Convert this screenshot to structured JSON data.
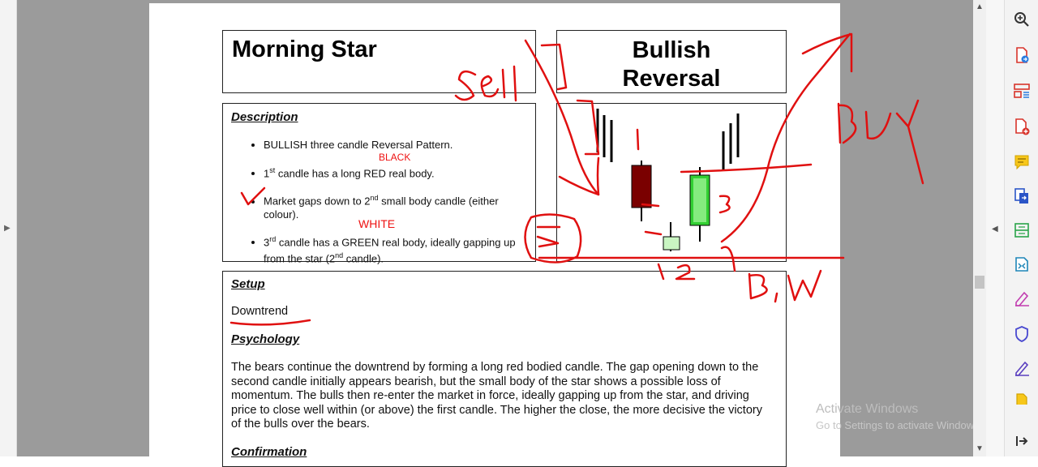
{
  "doc": {
    "title_left": "Morning Star",
    "title_right_line1": "Bullish",
    "title_right_line2": "Reversal",
    "description": {
      "heading": "Description",
      "bullets": [
        {
          "pre": "BULLISH three candle Reversal Pattern.",
          "sup": "",
          "post": ""
        },
        {
          "pre": "1",
          "sup": "st",
          "post": " candle has a long RED real body."
        },
        {
          "pre": "Market gaps down to 2",
          "sup": "nd",
          "post": " small body candle (either colour)."
        },
        {
          "pre": "3",
          "sup": "rd",
          "post": " candle has a GREEN real body, ideally gapping up from the star (2",
          "sup2": "nd",
          "post2": " candle)."
        }
      ]
    },
    "setup": {
      "heading": "Setup",
      "text": "Downtrend"
    },
    "psychology": {
      "heading": "Psychology",
      "text": "The bears continue the downtrend by forming a long red bodied candle. The gap opening down to the second candle initially appears bearish, but the small body of the star shows a possible loss of momentum. The bulls then re-enter the market in force, ideally gapping up from the star, and driving price to close well within (or above) the first candle. The higher the close, the more decisive the victory of the bulls over the bears."
    },
    "confirmation": {
      "heading": "Confirmation"
    }
  },
  "annotations": {
    "typed_black": "BLACK",
    "typed_white": "WHITE",
    "hand_sell": "Sell",
    "hand_buy": "BUY",
    "hand_bw": "B, W",
    "hand_1": "1",
    "hand_2": "2",
    "hand_3": "3",
    "ink_color": "#e01010"
  },
  "watermark": {
    "line1": "Activate Windows",
    "line2": "Go to Settings to activate Windows."
  },
  "toolbar_icons": [
    "zoom-icon",
    "export-pdf-icon",
    "organize-pages-icon",
    "create-pdf-icon",
    "comment-icon",
    "combine-files-icon",
    "scan-icon",
    "compress-icon",
    "fill-sign-icon",
    "protect-icon",
    "edit-icon",
    "stamp-icon",
    "expand-panel-icon"
  ],
  "colors": {
    "candle_red": "#7a0000",
    "candle_green": "#22c022",
    "viewer_bg": "#9b9b9b"
  }
}
